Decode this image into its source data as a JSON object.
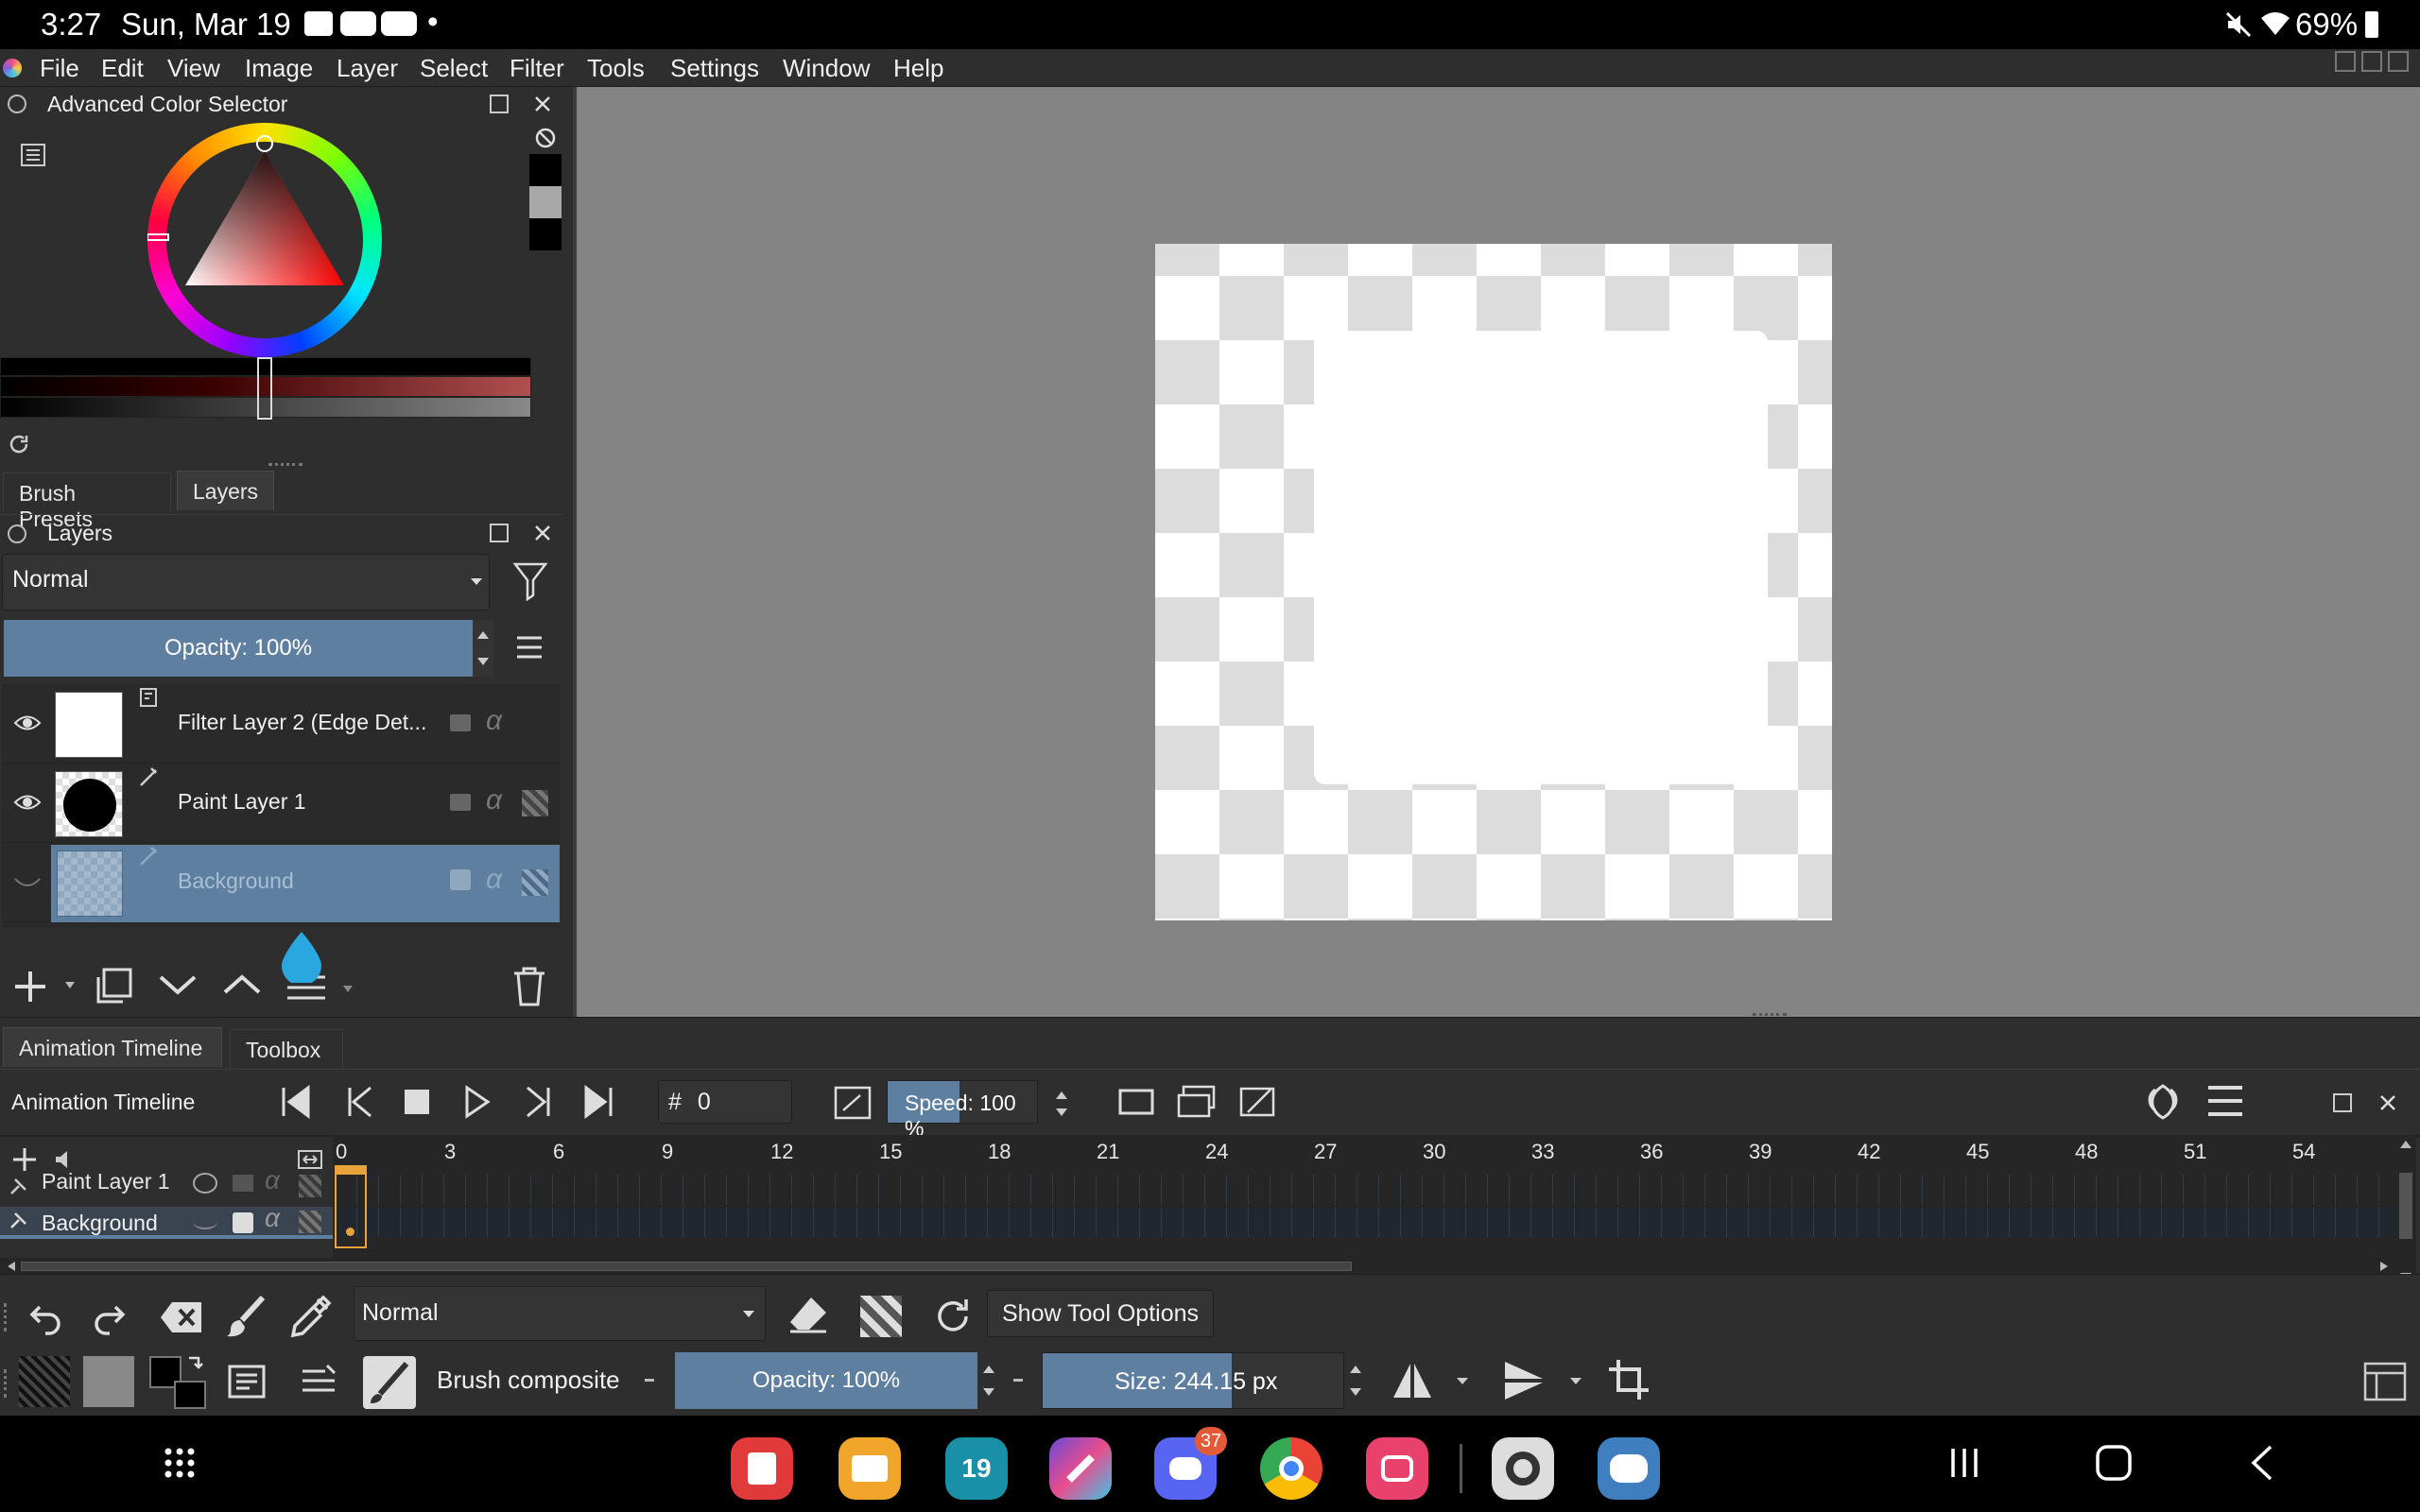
{
  "status_bar": {
    "time": "3:27",
    "date": "Sun, Mar 19",
    "dot": "•",
    "battery": "69%"
  },
  "menu": {
    "items": [
      "File",
      "Edit",
      "View",
      "Image",
      "Layer",
      "Select",
      "Filter",
      "Tools",
      "Settings",
      "Window",
      "Help"
    ]
  },
  "color_selector": {
    "title": "Advanced Color Selector"
  },
  "tabs": {
    "brush_presets": "Brush Presets",
    "layers": "Layers"
  },
  "layers_docker": {
    "title": "Layers",
    "blend_mode": "Normal",
    "opacity": "Opacity:  100%",
    "layers": [
      {
        "name": "Filter Layer 2 (Edge Det...",
        "visible": true,
        "selected": false
      },
      {
        "name": "Paint Layer 1",
        "visible": true,
        "selected": false
      },
      {
        "name": "Background",
        "visible": false,
        "selected": true
      }
    ]
  },
  "bottom_tabs": {
    "animation_timeline": "Animation Timeline",
    "toolbox": "Toolbox"
  },
  "timeline": {
    "title": "Animation Timeline",
    "frame_prefix": "#",
    "frame": "0",
    "speed": "Speed:  100 %",
    "ruler": [
      "0",
      "3",
      "6",
      "9",
      "12",
      "15",
      "18",
      "21",
      "24",
      "27",
      "30",
      "33",
      "36",
      "39",
      "42",
      "45",
      "48",
      "51",
      "54"
    ],
    "rows": [
      "Paint Layer 1",
      "Background"
    ]
  },
  "toolbar": {
    "blend_mode": "Normal",
    "show_tool_options": "Show Tool Options",
    "brush_name": "Brush composite",
    "opacity": "Opacity: 100%",
    "size": "Size: 244.15 px"
  },
  "nav": {
    "discord_badge": "37",
    "calendar_day": "19"
  },
  "colors": {
    "panel": "#2e2e2e",
    "selection": "#5e7fa0",
    "canvas_bg": "#848484",
    "accent_orange": "#e8a33a"
  }
}
